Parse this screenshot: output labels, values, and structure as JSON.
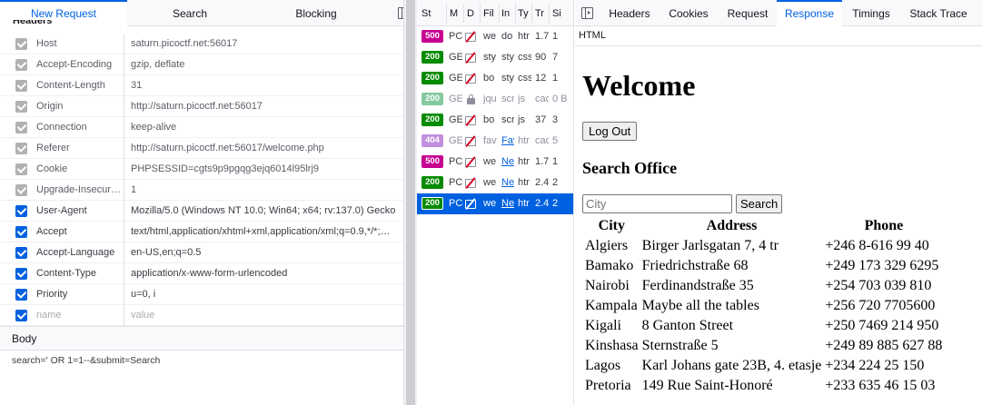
{
  "left_panel": {
    "tabs": [
      "New Request",
      "Search",
      "Blocking"
    ],
    "active_tab": "New Request",
    "section_title": "Headers",
    "headers": [
      {
        "name": "Host",
        "value": "saturn.picoctf.net:56017",
        "enabled": false
      },
      {
        "name": "Accept-Encoding",
        "value": "gzip, deflate",
        "enabled": false
      },
      {
        "name": "Content-Length",
        "value": "31",
        "enabled": false
      },
      {
        "name": "Origin",
        "value": "http://saturn.picoctf.net:56017",
        "enabled": false
      },
      {
        "name": "Connection",
        "value": "keep-alive",
        "enabled": false
      },
      {
        "name": "Referer",
        "value": "http://saturn.picoctf.net:56017/welcome.php",
        "enabled": false
      },
      {
        "name": "Cookie",
        "value": "PHPSESSID=cgts9p9pgqg3ejq6014l95lrj9",
        "enabled": false
      },
      {
        "name": "Upgrade-Insecur…",
        "value": "1",
        "enabled": false
      },
      {
        "name": "User-Agent",
        "value": "Mozilla/5.0 (Windows NT 10.0; Win64; x64; rv:137.0) Gecko…",
        "enabled": true
      },
      {
        "name": "Accept",
        "value": "text/html,application/xhtml+xml,application/xml;q=0.9,*/*;…",
        "enabled": true
      },
      {
        "name": "Accept-Language",
        "value": "en-US,en;q=0.5",
        "enabled": true
      },
      {
        "name": "Content-Type",
        "value": "application/x-www-form-urlencoded",
        "enabled": true
      },
      {
        "name": "Priority",
        "value": "u=0, i",
        "enabled": true
      },
      {
        "name": "name",
        "value": "value",
        "enabled": true,
        "placeholder": true
      }
    ],
    "body_label": "Body",
    "body_text": "search=' OR 1=1--&submit=Search"
  },
  "request_list": {
    "columns": [
      "St",
      "M",
      "D",
      "Fil",
      "In",
      "Ty",
      "Tr",
      "Si"
    ],
    "rows": [
      {
        "status": "500",
        "status_color": "#c60090",
        "method": "PC",
        "icon": "blocked-icon",
        "file": "we",
        "initiator": "do",
        "type": "htr",
        "transferred": "1.7",
        "size": "1",
        "link": false
      },
      {
        "status": "200",
        "status_color": "#058b00",
        "method": "GE",
        "icon": "blocked-icon",
        "file": "sty",
        "initiator": "sty",
        "type": "css",
        "transferred": "90",
        "size": "7",
        "link": false
      },
      {
        "status": "200",
        "status_color": "#058b00",
        "method": "GE",
        "icon": "blocked-icon",
        "file": "bo",
        "initiator": "sty",
        "type": "css",
        "transferred": "12",
        "size": "1",
        "link": false
      },
      {
        "status": "200",
        "status_color": "#84c9a0",
        "method": "GE",
        "icon": "lock-icon",
        "file": "jqu",
        "initiator": "scr",
        "type": "js",
        "transferred": "cac",
        "size": "0 B",
        "link": false,
        "muted": true
      },
      {
        "status": "200",
        "status_color": "#058b00",
        "method": "GE",
        "icon": "blocked-icon",
        "file": "bo",
        "initiator": "scr",
        "type": "js",
        "transferred": "37",
        "size": "3",
        "link": false
      },
      {
        "status": "404",
        "status_color": "#c28fdd",
        "method": "GE",
        "icon": "blocked-icon",
        "file": "fav",
        "initiator": "Fav",
        "type": "htr",
        "transferred": "cac",
        "size": "5",
        "link": true,
        "muted": true
      },
      {
        "status": "500",
        "status_color": "#c60090",
        "method": "PC",
        "icon": "blocked-icon",
        "file": "we",
        "initiator": "Ne",
        "type": "htr",
        "transferred": "1.7",
        "size": "1",
        "link": true
      },
      {
        "status": "200",
        "status_color": "#058b00",
        "method": "PC",
        "icon": "blocked-icon",
        "file": "we",
        "initiator": "Ne",
        "type": "htr",
        "transferred": "2.4",
        "size": "2",
        "link": true
      },
      {
        "status": "200",
        "status_color": "#058b00",
        "method": "PC",
        "icon": "blocked-icon",
        "file": "we",
        "initiator": "Ne",
        "type": "htr",
        "transferred": "2.4",
        "size": "2",
        "link": true,
        "selected": true
      }
    ]
  },
  "right_panel": {
    "tabs": [
      "Headers",
      "Cookies",
      "Request",
      "Response",
      "Timings",
      "Stack Trace"
    ],
    "active_tab": "Response",
    "format_label": "HTML",
    "preview": {
      "heading": "Welcome",
      "logout_label": "Log Out",
      "subheading": "Search Office",
      "search_placeholder": "City",
      "search_button": "Search",
      "table_headers": [
        "City",
        "Address",
        "Phone"
      ],
      "table_rows": [
        [
          "Algiers",
          "Birger Jarlsgatan 7, 4 tr",
          "+246 8-616 99 40"
        ],
        [
          "Bamako",
          "Friedrichstraße 68",
          "+249 173 329 6295"
        ],
        [
          "Nairobi",
          "Ferdinandstraße 35",
          "+254 703 039 810"
        ],
        [
          "Kampala",
          "Maybe all the tables",
          "+256 720 7705600"
        ],
        [
          "Kigali",
          "8 Ganton Street",
          "+250 7469 214 950"
        ],
        [
          "Kinshasa",
          "Sternstraße 5",
          "+249 89 885 627 88"
        ],
        [
          "Lagos",
          "Karl Johans gate 23B, 4. etasje",
          "+234 224 25 150"
        ],
        [
          "Pretoria",
          "149 Rue Saint-Honoré",
          "+233 635 46 15 03"
        ]
      ]
    }
  },
  "colors": {
    "accent": "#0061e0",
    "status_500": "#c60090",
    "status_200": "#058b00",
    "status_404": "#c28fdd"
  }
}
